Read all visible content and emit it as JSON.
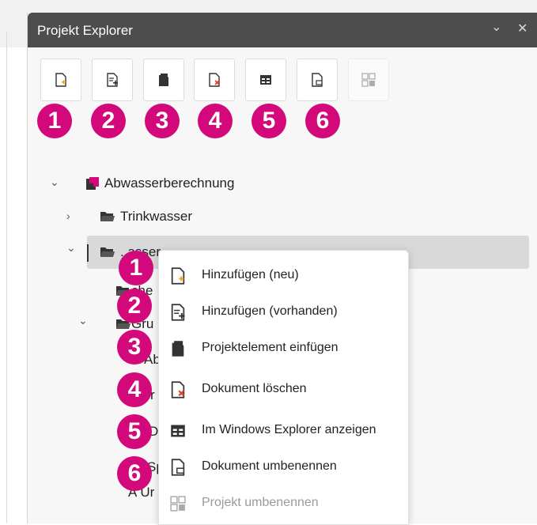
{
  "panel": {
    "title": "Projekt Explorer",
    "chevron_glyph": "⌄",
    "close_glyph": "✕"
  },
  "toolbar": {
    "buttons": [
      {
        "icon": "add-new-document-icon"
      },
      {
        "icon": "add-existing-document-icon"
      },
      {
        "icon": "insert-project-element-icon"
      },
      {
        "icon": "delete-document-icon"
      },
      {
        "icon": "windows-explorer-icon"
      },
      {
        "icon": "rename-document-icon"
      },
      {
        "icon": "rename-project-icon",
        "disabled": true
      }
    ]
  },
  "toolbar_badges": [
    "1",
    "2",
    "3",
    "4",
    "5",
    "6"
  ],
  "tree": {
    "root_label": "Abwasserberechnung",
    "child_trinkwasser": "Trinkwasser",
    "child_abwasser_partial": "..asser",
    "sub_sche_partial": "che",
    "sub_gru_partial": "Gru",
    "sub_ab_partial": "Ab",
    "sub_r_partial": "r",
    "sub_d_partial": "D",
    "sub_sp_partial": "Sp",
    "sub_ur_partial": "Ur",
    "letter_a": "A"
  },
  "context_menu": {
    "items": [
      {
        "label": "Hinzufügen (neu)",
        "icon": "add-new-document-icon"
      },
      {
        "label": "Hinzufügen (vorhanden)",
        "icon": "add-existing-document-icon"
      },
      {
        "label": "Projektelement einfügen",
        "icon": "insert-project-element-icon"
      },
      {
        "label": "Dokument löschen",
        "icon": "delete-document-icon"
      },
      {
        "label": "Im Windows Explorer anzeigen",
        "icon": "windows-explorer-icon"
      },
      {
        "label": "Dokument umbenennen",
        "icon": "rename-document-icon"
      },
      {
        "label": "Projekt umbenennen",
        "icon": "rename-project-icon",
        "disabled": true
      }
    ]
  },
  "menu_badges": [
    "1",
    "2",
    "3",
    "4",
    "5",
    "6"
  ],
  "colors": {
    "accent_badge": "#d3087b",
    "titlebar": "#4d4d4d",
    "selection": "#d9d9d9",
    "delete_mark": "#e0442f",
    "add_mark": "#f2a020"
  }
}
